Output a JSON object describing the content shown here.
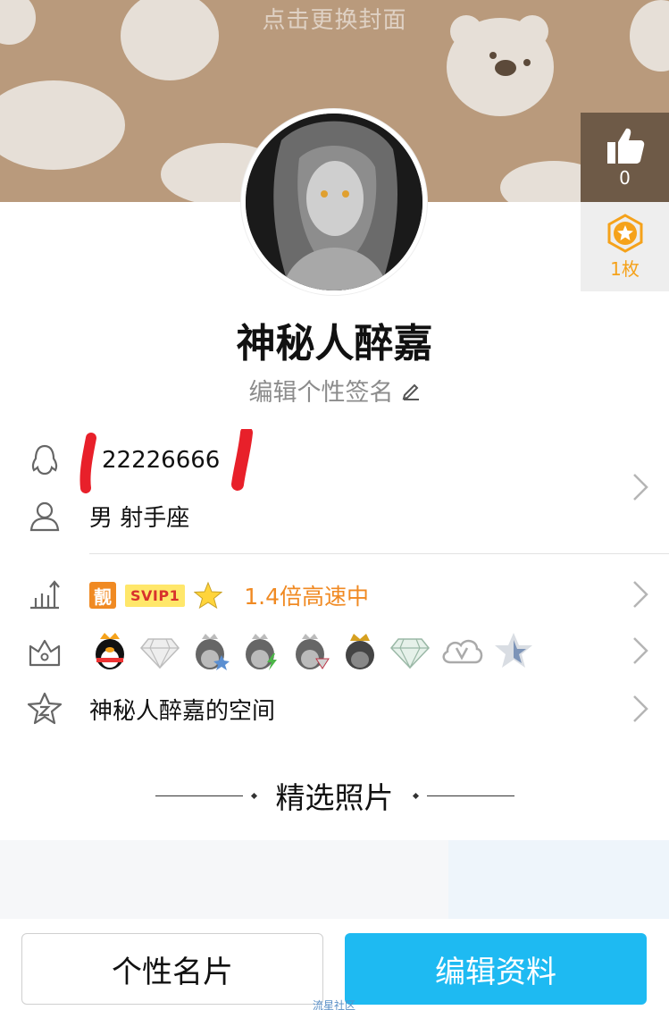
{
  "cover": {
    "hint": "点击更换封面"
  },
  "like": {
    "count": "0"
  },
  "medal": {
    "count": "1枚"
  },
  "profile": {
    "nickname": "神秘人醉嘉",
    "signature": "编辑个性签名"
  },
  "info": {
    "qq_number": "22226666",
    "gender_sign": "男 射手座"
  },
  "vip": {
    "liang": "靓",
    "svip": "SVIP1",
    "speed": "1.4倍高速中"
  },
  "medals": [
    "penguin-crown-icon",
    "diamond-icon",
    "penguin-star-icon",
    "penguin-lightning-icon",
    "penguin-gem-icon",
    "penguin-crown-dark-icon",
    "diamond-green-icon",
    "cloud-v-icon",
    "star-blue-icon"
  ],
  "space": {
    "label": "神秘人醉嘉的空间"
  },
  "section": {
    "title": "精选照片"
  },
  "buttons": {
    "card": "个性名片",
    "edit": "编辑资料"
  },
  "watermark": "流星社区",
  "colors": {
    "accent": "#1ebaf2",
    "orange": "#f08a23",
    "cover": "#b99a7c"
  }
}
